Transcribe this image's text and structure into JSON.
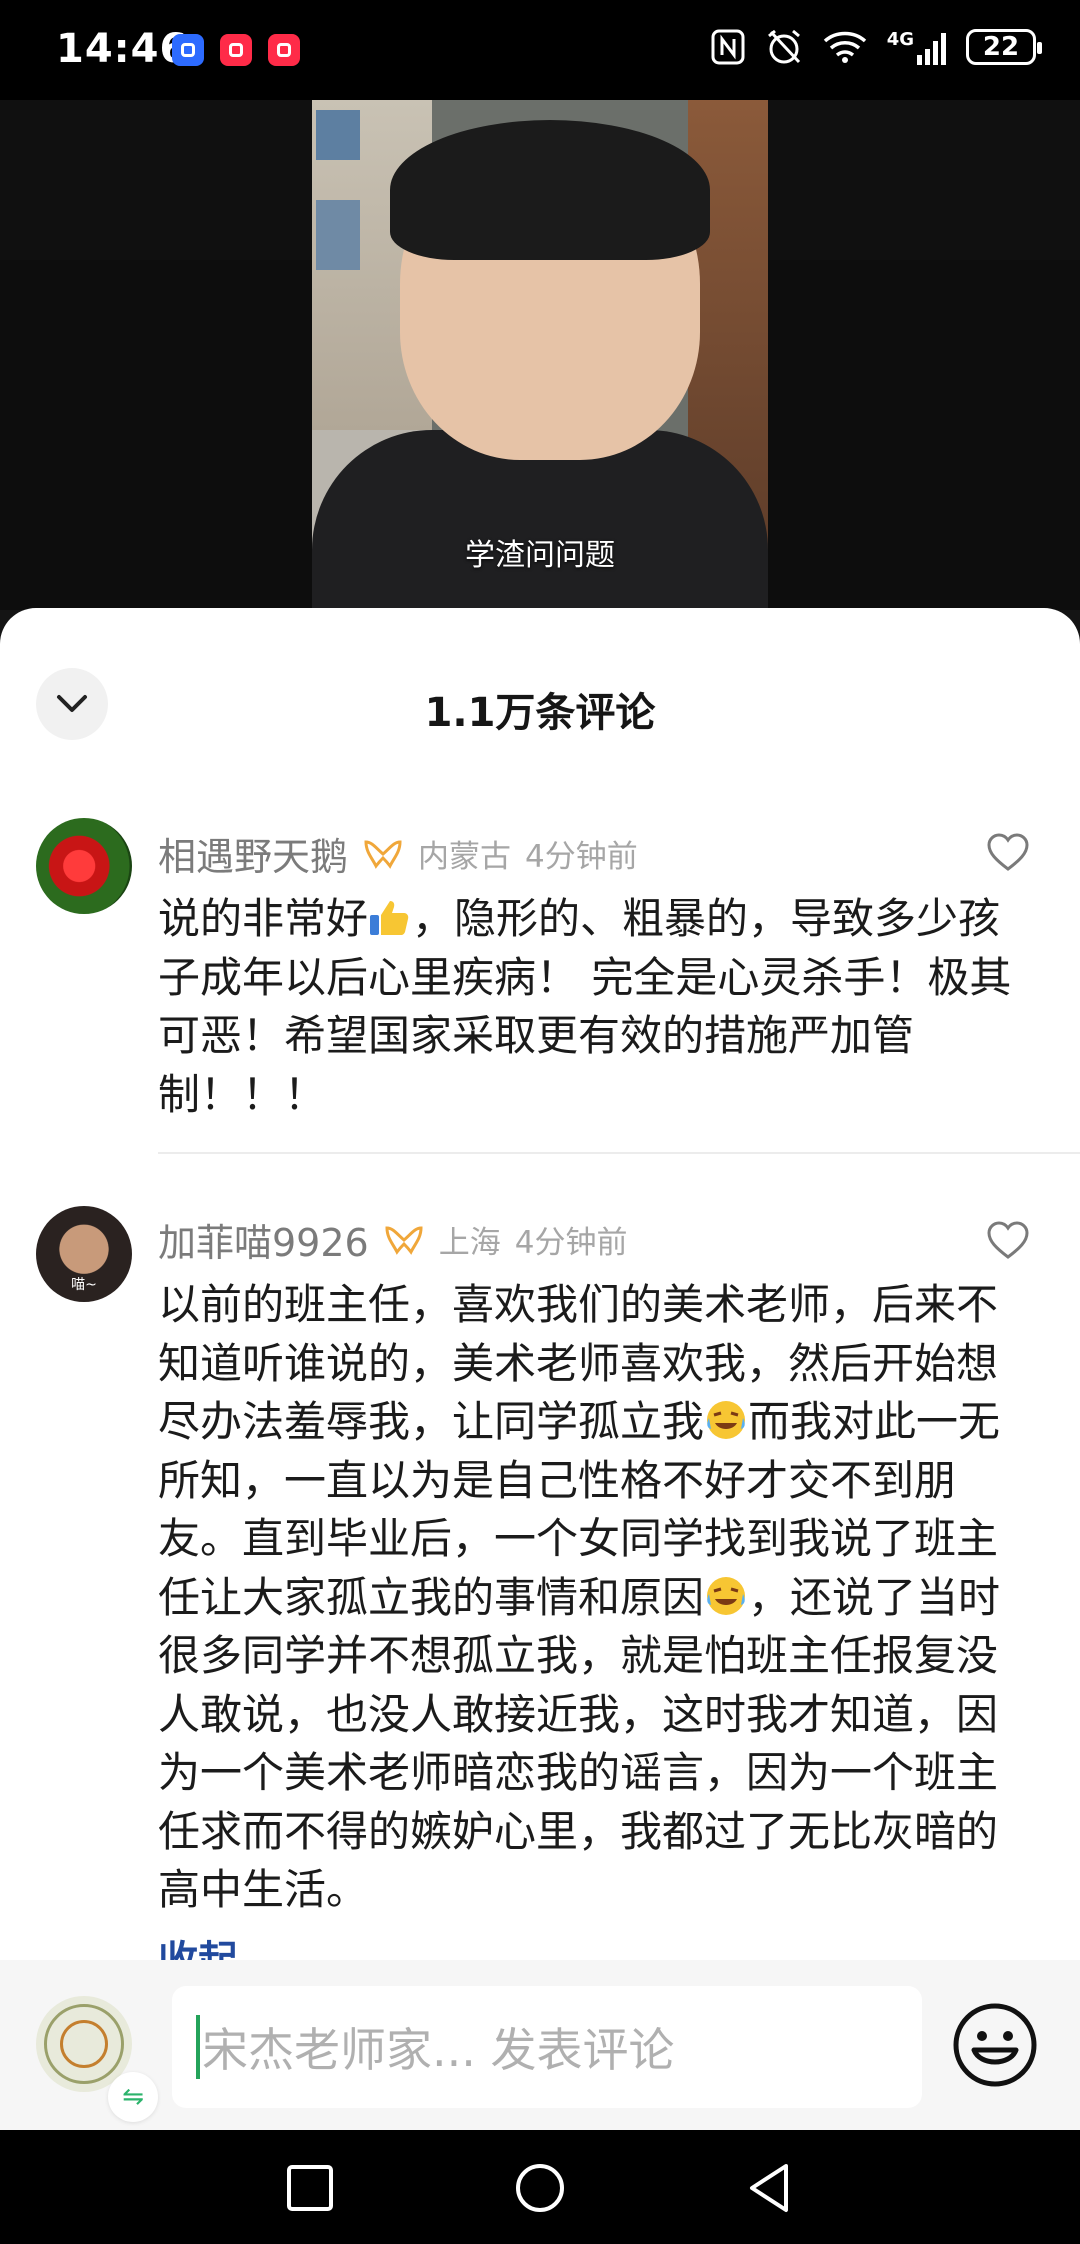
{
  "status_bar": {
    "time": "14:46",
    "network": "4G",
    "battery": "22"
  },
  "video": {
    "subtitle": "学渣问问题"
  },
  "comments_panel": {
    "title": "1.1万条评论",
    "comments": [
      {
        "username": "相遇野天鹅",
        "location": "内蒙古",
        "time": "4分钟前",
        "text_parts": [
          "说的非常好",
          "，隐形的、粗暴的，导致多少孩子成年以后心里疾病！ 完全是心灵杀手！极其可恶！希望国家采取更有效的措施严加管制！！！"
        ],
        "emoji": [
          "thumbs-up"
        ]
      },
      {
        "username": "加菲喵9926",
        "location": "上海",
        "time": "4分钟前",
        "avatar_tag": "喵~",
        "text_parts": [
          "以前的班主任，喜欢我们的美术老师，后来不知道听谁说的，美术老师喜欢我，然后开始想尽办法羞辱我，让同学孤立我",
          "而我对此一无所知，一直以为是自己性格不好才交不到朋友。直到毕业后，一个女同学找到我说了班主任让大家孤立我的事情和原因",
          "，还说了当时很多同学并不想孤立我，就是怕班主任报复没人敢说，也没人敢接近我，这时我才知道，因为一个美术老师暗恋我的谣言，因为一个班主任求而不得的嫉妒心里，我都过了无比灰暗的高中生活。"
        ],
        "emoji": [
          "laugh-cry",
          "laugh-cry"
        ],
        "collapse_label": "收起"
      }
    ]
  },
  "input_bar": {
    "placeholder": "宋杰老师家... 发表评论"
  },
  "colors": {
    "accent_link": "#214a9e",
    "badge_gold": "#f0a73a",
    "caret_green": "#24a35a"
  }
}
